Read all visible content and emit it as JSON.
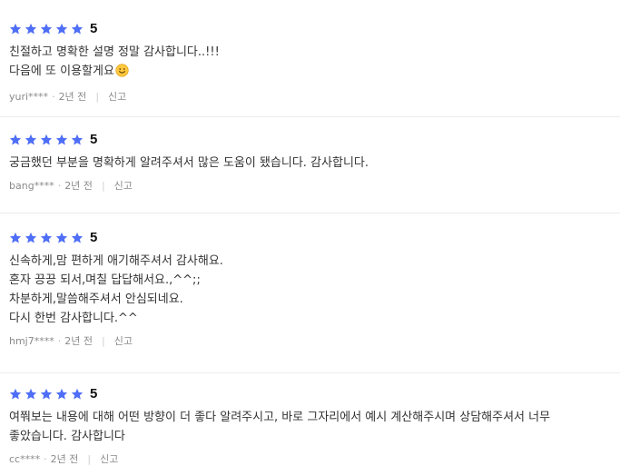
{
  "reviews": [
    {
      "stars": 5,
      "score": "5",
      "lines": "친절하고 명확한 설명 정말 감사합니다..!!!\n다음에 또 이용할게요",
      "emoji": "smiling-face-emoji",
      "user": "yuri****",
      "time": "2년 전",
      "report": "신고"
    },
    {
      "stars": 5,
      "score": "5",
      "lines": "궁금했던 부분을 명확하게 알려주셔서 많은 도움이 됐습니다. 감사합니다.",
      "user": "bang****",
      "time": "2년 전",
      "report": "신고"
    },
    {
      "stars": 5,
      "score": "5",
      "lines": "신속하게,맘 편하게 애기해주셔서 감사해요.\n혼자 끙끙 되서,며칠 답답해서요.,^^;;\n차분하게,말씀해주셔서 안심되네요.\n다시 한번 감사합니다.^^",
      "user": "hmj7****",
      "time": "2년 전",
      "report": "신고"
    },
    {
      "stars": 5,
      "score": "5",
      "lines": "여쭤보는 내용에 대해 어떤 방향이 더 좋다 알려주시고, 바로 그자리에서 예시 계산해주시며 상담해주셔서 너무\n좋았습니다. 감사합니다",
      "user": "cc****",
      "time": "2년 전",
      "report": "신고"
    }
  ],
  "colors": {
    "star": "#4f6ef7",
    "text": "#333333",
    "meta": "#8a8a8a",
    "divider": "#ececec"
  }
}
